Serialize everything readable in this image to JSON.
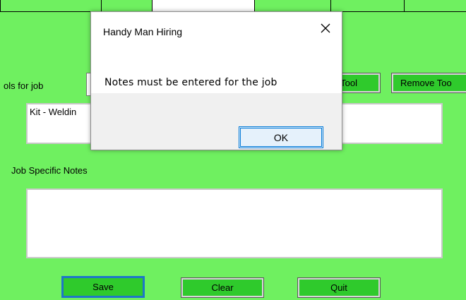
{
  "dialog": {
    "title": "Handy Man Hiring",
    "message": "Notes must be entered for the job",
    "ok_label": "OK"
  },
  "form": {
    "tools_label": "ols for job",
    "add_tool_label": "Tool",
    "remove_tool_label": "Remove Too",
    "tools_list": [
      "Kit - Weldin"
    ],
    "notes_label": "Job Specific Notes",
    "notes_value": "",
    "save_label": "Save",
    "clear_label": "Clear",
    "quit_label": "Quit"
  },
  "colors": {
    "form_bg": "#6ff060",
    "button_bg": "#2fca2c",
    "focus_accent": "#0078d7"
  }
}
